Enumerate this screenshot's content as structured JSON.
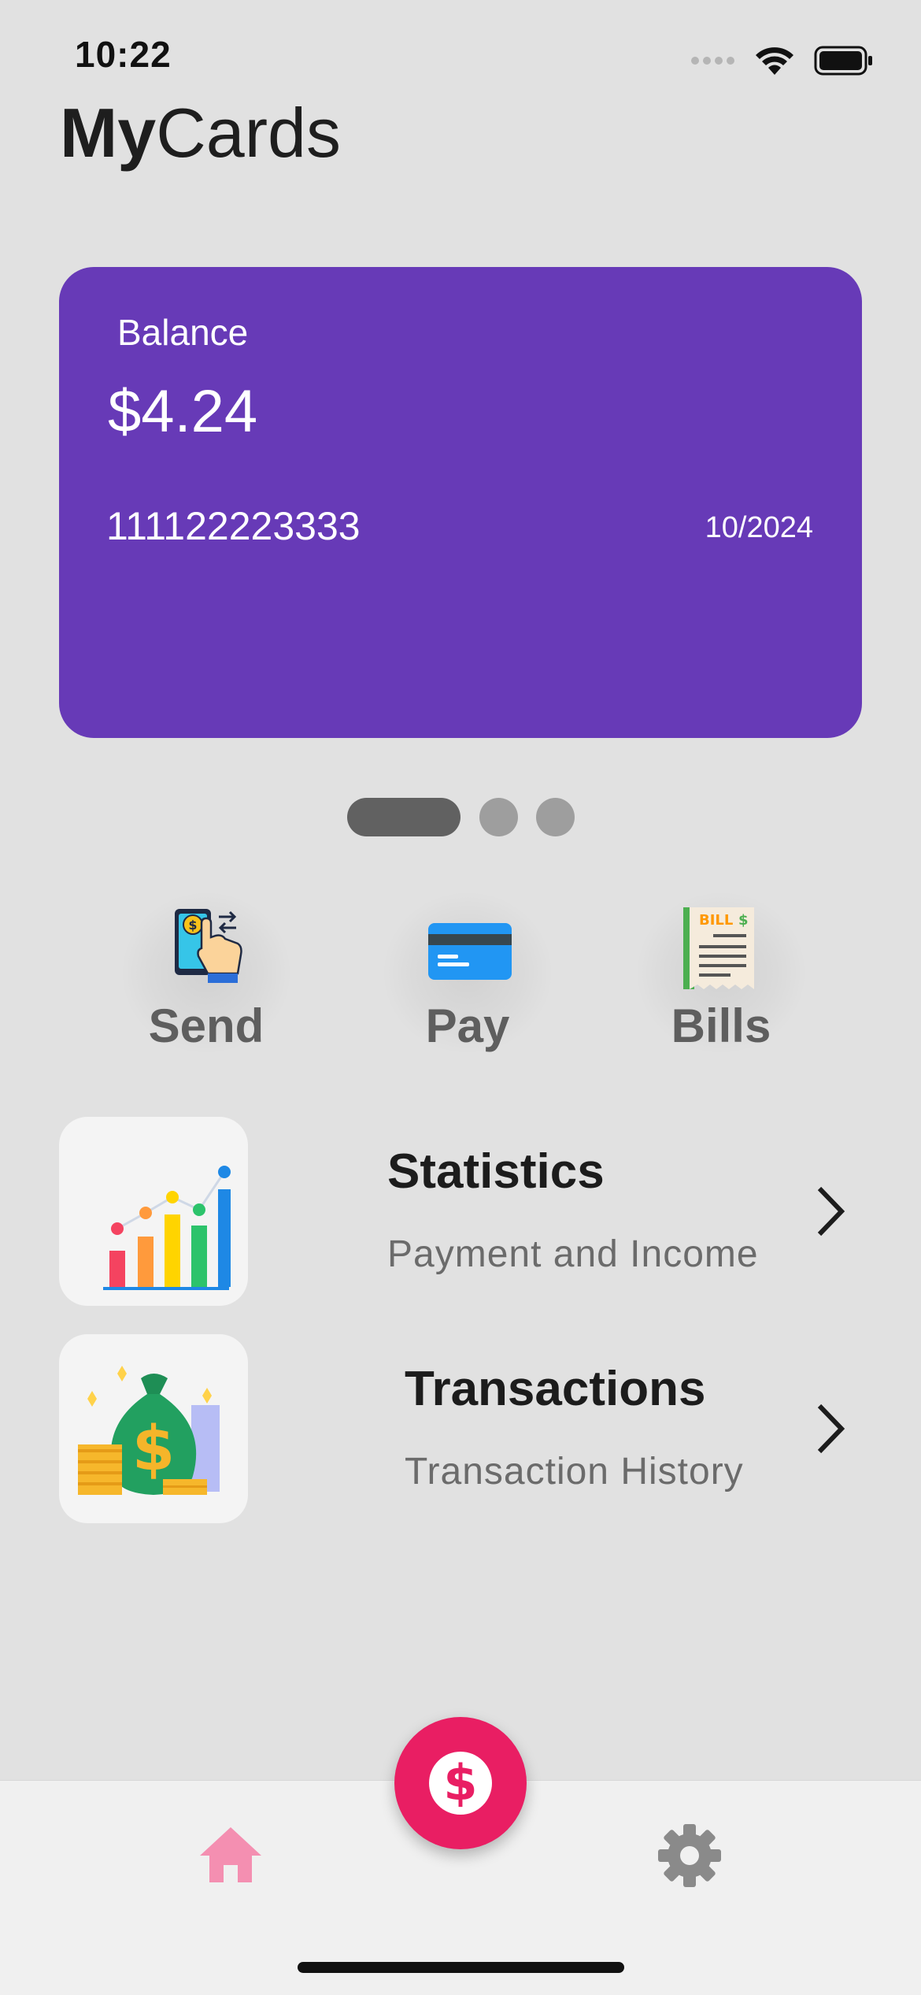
{
  "status_bar": {
    "time": "10:22"
  },
  "header": {
    "title_bold": "My",
    "title_regular": "Cards"
  },
  "card": {
    "balance_label": "Balance",
    "balance_amount": "$4.24",
    "card_number": "111122223333",
    "expiry": "10/2024",
    "color": "#673ab7"
  },
  "pager": {
    "pages": 3,
    "active_index": 0
  },
  "actions": [
    {
      "label": "Send",
      "icon": "send-money-icon"
    },
    {
      "label": "Pay",
      "icon": "credit-card-icon"
    },
    {
      "label": "Bills",
      "icon": "bill-receipt-icon"
    }
  ],
  "menu": [
    {
      "title": "Statistics",
      "subtitle": "Payment and Income",
      "icon": "bar-chart-icon"
    },
    {
      "title": "Transactions",
      "subtitle": "Transaction History",
      "icon": "money-bag-icon"
    }
  ],
  "bottom_nav": {
    "home_icon": "home-icon",
    "fab_icon": "dollar-icon",
    "settings_icon": "gear-icon",
    "accent": "#e91e63"
  }
}
